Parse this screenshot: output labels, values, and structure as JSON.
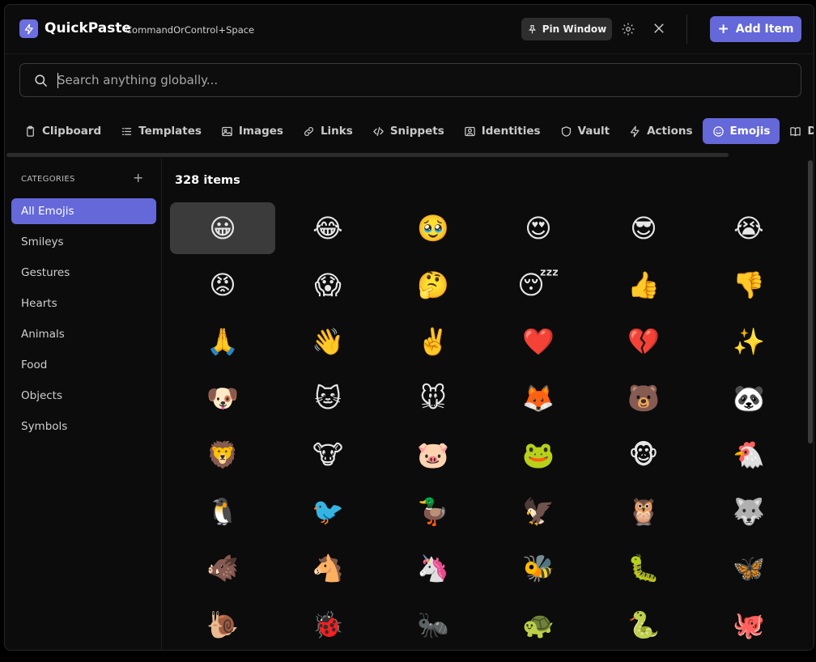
{
  "app": {
    "name": "QuickPaste",
    "shortcut": "CommandOrControl+Space",
    "accent": "#6468d8"
  },
  "header": {
    "pin_label": "Pin Window",
    "add_label": "Add Item"
  },
  "search": {
    "placeholder": "Search anything globally...",
    "value": ""
  },
  "tabs": [
    {
      "label": "Clipboard",
      "icon": "clipboard-icon"
    },
    {
      "label": "Templates",
      "icon": "list-icon"
    },
    {
      "label": "Images",
      "icon": "image-icon"
    },
    {
      "label": "Links",
      "icon": "link-icon"
    },
    {
      "label": "Snippets",
      "icon": "code-icon"
    },
    {
      "label": "Identities",
      "icon": "id-card-icon"
    },
    {
      "label": "Vault",
      "icon": "shield-icon"
    },
    {
      "label": "Actions",
      "icon": "bolt-icon"
    },
    {
      "label": "Emojis",
      "icon": "smiley-icon",
      "active": true
    },
    {
      "label": "Documents",
      "icon": "book-icon"
    }
  ],
  "sidebar": {
    "title": "CATEGORIES",
    "add_label": "+",
    "items": [
      {
        "label": "All Emojis",
        "active": true
      },
      {
        "label": "Smileys"
      },
      {
        "label": "Gestures"
      },
      {
        "label": "Hearts"
      },
      {
        "label": "Animals"
      },
      {
        "label": "Food"
      },
      {
        "label": "Objects"
      },
      {
        "label": "Symbols"
      }
    ]
  },
  "main": {
    "count_label": "328 items",
    "emojis": [
      "😀",
      "😂",
      "🥹",
      "😍",
      "😎",
      "😭",
      "😡",
      "😱",
      "🤔",
      "😴",
      "👍",
      "👎",
      "🙏",
      "👋",
      "✌️",
      "❤️",
      "💔",
      "✨",
      "🐶",
      "🐱",
      "🐭",
      "🦊",
      "🐻",
      "🐼",
      "🦁",
      "🐮",
      "🐷",
      "🐸",
      "🐵",
      "🐔",
      "🐧",
      "🐦",
      "🦆",
      "🦅",
      "🦉",
      "🐺",
      "🐗",
      "🐴",
      "🦄",
      "🐝",
      "🐛",
      "🦋",
      "🐌",
      "🐞",
      "🐜",
      "🐢",
      "🐍",
      "🐙"
    ]
  }
}
